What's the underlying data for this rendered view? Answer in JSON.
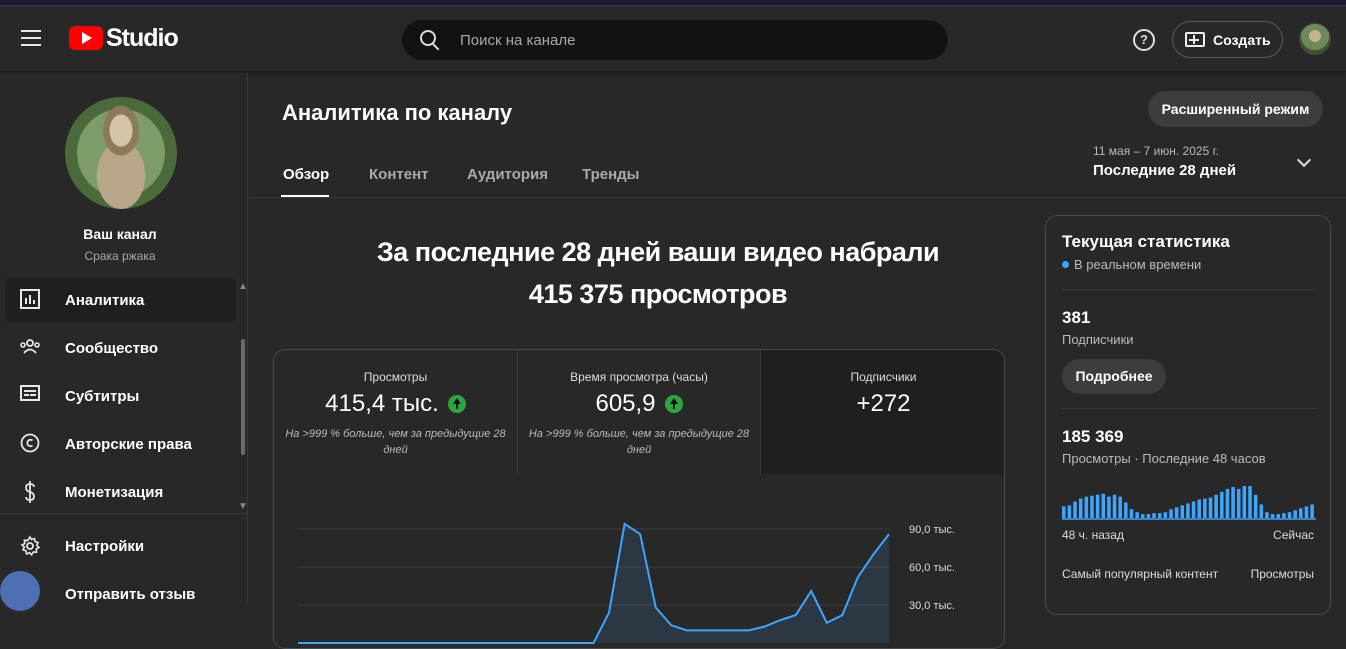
{
  "header": {
    "logo_text": "Studio",
    "search_placeholder": "Поиск на канале",
    "help_symbol": "?",
    "create_label": "Создать"
  },
  "sidebar": {
    "channel_name": "Ваш канал",
    "channel_handle": "Срака ржака",
    "items": [
      {
        "label": "Аналитика",
        "icon": "analytics-icon",
        "active": true
      },
      {
        "label": "Сообщество",
        "icon": "community-icon"
      },
      {
        "label": "Субтитры",
        "icon": "subtitles-icon"
      },
      {
        "label": "Авторские права",
        "icon": "copyright-icon"
      },
      {
        "label": "Монетизация",
        "icon": "dollar-icon"
      }
    ],
    "bottom_items": [
      {
        "label": "Настройки",
        "icon": "gear-icon"
      },
      {
        "label": "Отправить отзыв",
        "icon": "feedback-icon"
      }
    ]
  },
  "main": {
    "title": "Аналитика по каналу",
    "advanced_button": "Расширенный режим",
    "tabs": [
      {
        "label": "Обзор",
        "active": true
      },
      {
        "label": "Контент"
      },
      {
        "label": "Аудитория"
      },
      {
        "label": "Тренды"
      }
    ],
    "date_range": "11 мая – 7 июн. 2025 г.",
    "date_label": "Последние 28 дней",
    "headline_line1": "За последние 28 дней ваши видео набрали",
    "headline_line2": "415 375 просмотров",
    "metrics": [
      {
        "label": "Просмотры",
        "value": "415,4 тыс.",
        "trend": "up",
        "note": "На >999 % больше, чем за предыдущие 28 дней"
      },
      {
        "label": "Время просмотра (часы)",
        "value": "605,9",
        "trend": "up",
        "note": "На >999 % больше, чем за предыдущие 28 дней"
      },
      {
        "label": "Подписчики",
        "value": "+272",
        "trend": "",
        "note": ""
      }
    ]
  },
  "chart_data": {
    "type": "area",
    "yticks": [
      "90,0 тыс.",
      "60,0 тыс.",
      "30,0 тыс."
    ],
    "ytick_values": [
      90000,
      60000,
      30000
    ],
    "ylim": [
      0,
      100000
    ],
    "values": [
      0,
      0,
      0,
      0,
      0,
      0,
      0,
      0,
      0,
      0,
      0,
      0,
      0,
      0,
      0,
      0,
      0,
      0,
      0,
      0,
      24000,
      94000,
      86000,
      28000,
      14000,
      10000,
      10000,
      10000,
      10000,
      10000,
      13000,
      18000,
      22000,
      41000,
      16000,
      22000,
      52000,
      70000,
      86000
    ],
    "color": "#3ea6ff"
  },
  "realtime": {
    "title": "Текущая статистика",
    "realtime_label": "В реальном времени",
    "subscribers_value": "381",
    "subscribers_label": "Подписчики",
    "more_button": "Подробнее",
    "views_value": "185 369",
    "views_label": "Просмотры · Последние 48 часов",
    "axis_left": "48 ч. назад",
    "axis_right": "Сейчас",
    "popular_label": "Самый популярный контент",
    "popular_metric": "Просмотры",
    "bar_color": "#3ea6ff",
    "bar_values": [
      12,
      13,
      17,
      20,
      22,
      23,
      24,
      25,
      22,
      24,
      22,
      16,
      9,
      6,
      4,
      4,
      5,
      5,
      6,
      9,
      11,
      13,
      15,
      17,
      19,
      20,
      21,
      24,
      27,
      30,
      32,
      30,
      33,
      33,
      24,
      14,
      6,
      4,
      4,
      5,
      6,
      8,
      10,
      12,
      14
    ]
  }
}
